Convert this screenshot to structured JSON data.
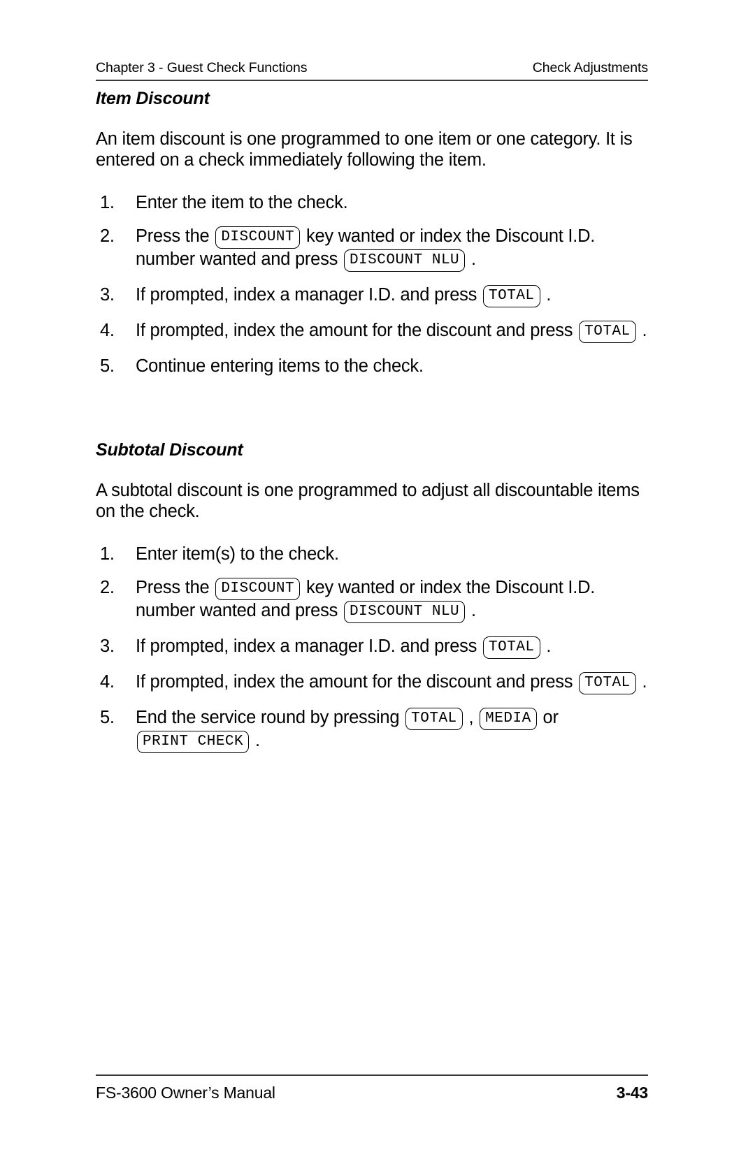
{
  "header": {
    "left": "Chapter 3 - Guest Check Functions",
    "right": "Check Adjustments"
  },
  "sections": [
    {
      "heading": "Item Discount",
      "intro": "An item discount is one programmed to one item or one category.  It is entered on a check immediately following the item.",
      "steps": [
        {
          "number": "1.",
          "parts": [
            {
              "type": "text",
              "value": "Enter the item to the check."
            }
          ]
        },
        {
          "number": "2.",
          "parts": [
            {
              "type": "text",
              "value": "Press the "
            },
            {
              "type": "key",
              "value": "DISCOUNT"
            },
            {
              "type": "text",
              "value": " key wanted or index the Discount I.D. number wanted and press "
            },
            {
              "type": "key",
              "value": "DISCOUNT NLU"
            },
            {
              "type": "text",
              "value": " ."
            }
          ]
        },
        {
          "number": "3.",
          "parts": [
            {
              "type": "text",
              "value": "If prompted, index a manager I.D. and press "
            },
            {
              "type": "key",
              "value": "TOTAL"
            },
            {
              "type": "text",
              "value": " ."
            }
          ]
        },
        {
          "number": "4.",
          "parts": [
            {
              "type": "text",
              "value": "If prompted, index the amount for the discount and press "
            },
            {
              "type": "key",
              "value": "TOTAL"
            },
            {
              "type": "text",
              "value": " ."
            }
          ]
        },
        {
          "number": "5.",
          "parts": [
            {
              "type": "text",
              "value": "Continue entering items to the check."
            }
          ]
        }
      ]
    },
    {
      "heading": "Subtotal Discount",
      "intro": "A subtotal discount is one programmed to adjust all discountable items on the check.",
      "steps": [
        {
          "number": "1.",
          "parts": [
            {
              "type": "text",
              "value": "Enter item(s) to the check."
            }
          ]
        },
        {
          "number": "2.",
          "parts": [
            {
              "type": "text",
              "value": "Press the "
            },
            {
              "type": "key",
              "value": "DISCOUNT"
            },
            {
              "type": "text",
              "value": " key wanted or index the Discount I.D. number wanted and press "
            },
            {
              "type": "key",
              "value": "DISCOUNT NLU"
            },
            {
              "type": "text",
              "value": " ."
            }
          ]
        },
        {
          "number": "3.",
          "parts": [
            {
              "type": "text",
              "value": "If prompted, index a manager I.D. and press "
            },
            {
              "type": "key",
              "value": "TOTAL"
            },
            {
              "type": "text",
              "value": " ."
            }
          ]
        },
        {
          "number": "4.",
          "parts": [
            {
              "type": "text",
              "value": "If prompted, index the amount for the discount and press "
            },
            {
              "type": "key",
              "value": "TOTAL"
            },
            {
              "type": "text",
              "value": " ."
            }
          ]
        },
        {
          "number": "5.",
          "parts": [
            {
              "type": "text",
              "value": "End the service round by pressing "
            },
            {
              "type": "key",
              "value": "TOTAL"
            },
            {
              "type": "text",
              "value": " , "
            },
            {
              "type": "key",
              "value": "MEDIA"
            },
            {
              "type": "text",
              "value": " or "
            },
            {
              "type": "key",
              "value": "PRINT CHECK"
            },
            {
              "type": "text",
              "value": " ."
            }
          ]
        }
      ]
    }
  ],
  "footer": {
    "left": "FS-3600 Owner’s Manual",
    "right": "3-43"
  }
}
